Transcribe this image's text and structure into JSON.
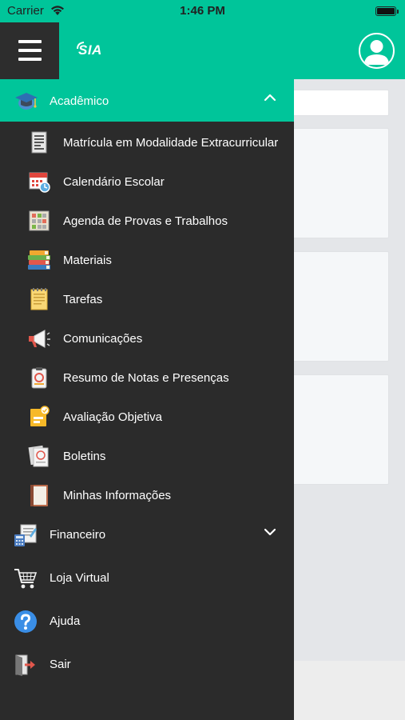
{
  "status_bar": {
    "carrier": "Carrier",
    "time": "1:46 PM"
  },
  "header": {
    "logo": "SIA"
  },
  "drawer": {
    "section": {
      "label": "Acadêmico",
      "expanded": true
    },
    "sub_items": [
      {
        "label": "Matrícula em Modalidade Extracurricular",
        "icon": "document-icon"
      },
      {
        "label": "Calendário Escolar",
        "icon": "calendar-icon"
      },
      {
        "label": "Agenda de Provas e Trabalhos",
        "icon": "schedule-icon"
      },
      {
        "label": "Materiais",
        "icon": "books-icon"
      },
      {
        "label": "Tarefas",
        "icon": "notepad-icon"
      },
      {
        "label": "Comunicações",
        "icon": "megaphone-icon"
      },
      {
        "label": "Resumo de Notas e Presenças",
        "icon": "clipboard-icon"
      },
      {
        "label": "Avaliação Objetiva",
        "icon": "evaluation-icon"
      },
      {
        "label": "Boletins",
        "icon": "report-card-icon"
      },
      {
        "label": "Minhas Informações",
        "icon": "notebook-icon"
      }
    ],
    "top_items": [
      {
        "label": "Financeiro",
        "icon": "finance-icon",
        "expandable": true
      },
      {
        "label": "Loja Virtual",
        "icon": "cart-icon"
      },
      {
        "label": "Ajuda",
        "icon": "help-icon"
      },
      {
        "label": "Sair",
        "icon": "logout-icon"
      }
    ]
  },
  "colors": {
    "accent": "#00c59a",
    "drawer_bg": "#2b2b2b",
    "content_bg": "#e4e6e9"
  }
}
